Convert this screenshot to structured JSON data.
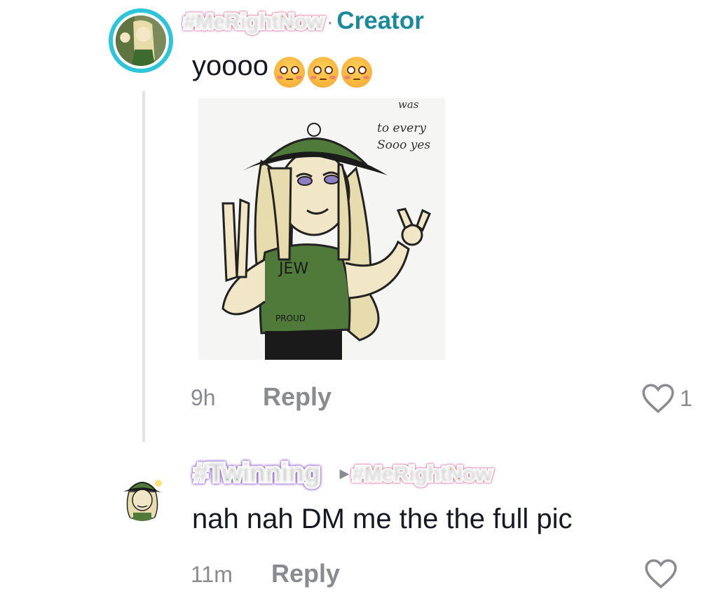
{
  "comment1": {
    "username": "#MeRightNow",
    "separator": "·",
    "badge": "Creator",
    "text": "yoooo",
    "emoji_count": 3,
    "emoji_name": "flushed-face",
    "time": "9h",
    "reply_label": "Reply",
    "like_count": "1",
    "image_text_lines": [
      "was",
      "to every",
      "Sooo yes"
    ],
    "shirt_text": [
      "JEW",
      "PROUD"
    ]
  },
  "comment2": {
    "username": "#Twinning",
    "reply_to": "#MeRightNow",
    "text": "nah nah DM me the the full pic",
    "time": "11m",
    "reply_label": "Reply"
  },
  "colors": {
    "avatar_ring": "#2ec4d9",
    "creator_badge": "#1a8a9a",
    "muted_text": "#8a8b91",
    "hat_green": "#4f7a3a"
  }
}
